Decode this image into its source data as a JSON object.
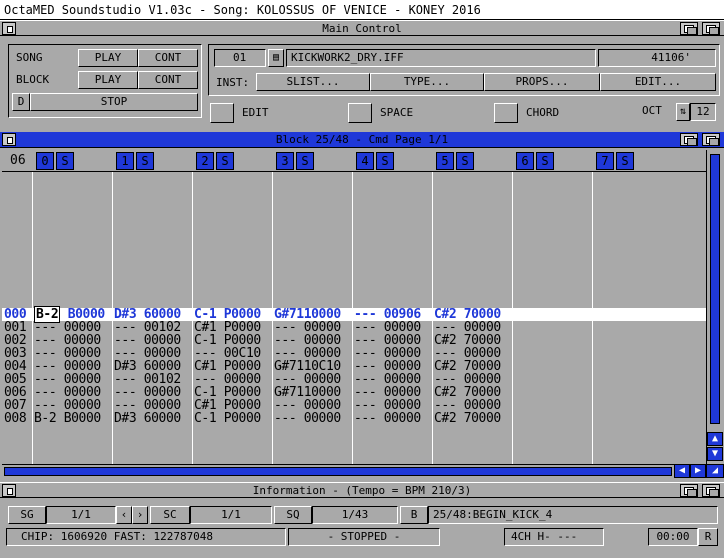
{
  "screen_title": "OctaMED Soundstudio V1.03c - Song: KOLOSSUS OF VENICE - KONEY 2016",
  "main_control": {
    "title": "Main Control",
    "song_label": "SONG",
    "block_label": "BLOCK",
    "play_label": "PLAY",
    "cont_label": "CONT",
    "d_label": "D",
    "stop_label": "STOP",
    "inst_number": "01",
    "inst_name": "KICKWORK2_DRY.IFF",
    "inst_length": "41106'",
    "inst_label": "INST:",
    "slist_label": "SLIST...",
    "type_label": "TYPE...",
    "props_label": "PROPS...",
    "edit_menu_label": "EDIT...",
    "edit_toggle_label": "EDIT",
    "space_toggle_label": "SPACE",
    "chord_toggle_label": "CHORD",
    "oct_label": "OCT",
    "oct_value": "12"
  },
  "block_editor": {
    "title": "Block 25/48 - Cmd Page 1/1",
    "lines_label": "06",
    "tracks": [
      "0",
      "1",
      "2",
      "3",
      "4",
      "5",
      "6",
      "7"
    ],
    "solo_label": "S",
    "rows": [
      {
        "line": "000",
        "t0": "B-2 B0000",
        "t1": "D#3 60000",
        "t2": "C-1 P0000",
        "t3": "G#7110000",
        "t4": "--- 00906",
        "t5": "C#2 70000"
      },
      {
        "line": "001",
        "t0": "--- 00000",
        "t1": "--- 00102",
        "t2": "C#1 P0000",
        "t3": "--- 00000",
        "t4": "--- 00000",
        "t5": "--- 00000"
      },
      {
        "line": "002",
        "t0": "--- 00000",
        "t1": "--- 00000",
        "t2": "C-1 P0000",
        "t3": "--- 00000",
        "t4": "--- 00000",
        "t5": "C#2 70000"
      },
      {
        "line": "003",
        "t0": "--- 00000",
        "t1": "--- 00000",
        "t2": "--- 00C10",
        "t3": "--- 00000",
        "t4": "--- 00000",
        "t5": "--- 00000"
      },
      {
        "line": "004",
        "t0": "--- 00000",
        "t1": "D#3 60000",
        "t2": "C#1 P0000",
        "t3": "G#7110C10",
        "t4": "--- 00000",
        "t5": "C#2 70000"
      },
      {
        "line": "005",
        "t0": "--- 00000",
        "t1": "--- 00102",
        "t2": "--- 00000",
        "t3": "--- 00000",
        "t4": "--- 00000",
        "t5": "--- 00000"
      },
      {
        "line": "006",
        "t0": "--- 00000",
        "t1": "--- 00000",
        "t2": "C-1 P0000",
        "t3": "G#7110000",
        "t4": "--- 00000",
        "t5": "C#2 70000"
      },
      {
        "line": "007",
        "t0": "--- 00000",
        "t1": "--- 00000",
        "t2": "C#1 P0000",
        "t3": "--- 00000",
        "t4": "--- 00000",
        "t5": "--- 00000"
      },
      {
        "line": "008",
        "t0": "B-2 B0000",
        "t1": "D#3 60000",
        "t2": "C-1 P0000",
        "t3": "--- 00000",
        "t4": "--- 00000",
        "t5": "C#2 70000"
      }
    ]
  },
  "information": {
    "title": "Information - (Tempo = BPM 210/3)",
    "sg_label": "SG",
    "sg_value": "1/1",
    "prev_label": "‹",
    "next_label": "›",
    "sc_label": "SC",
    "sc_value": "1/1",
    "sq_label": "SQ",
    "sq_value": "1/43",
    "b_label": "B",
    "block_name": "25/48:BEGIN_KICK_4",
    "mem_text": "CHIP: 1606920 FAST: 122787048",
    "status_text": "- STOPPED -",
    "channel_text": "4CH H- ---",
    "time_text": "00:00",
    "r_label": "R"
  },
  "colors": {
    "accent": "#1f38d8",
    "background": "#a9a9a9"
  }
}
